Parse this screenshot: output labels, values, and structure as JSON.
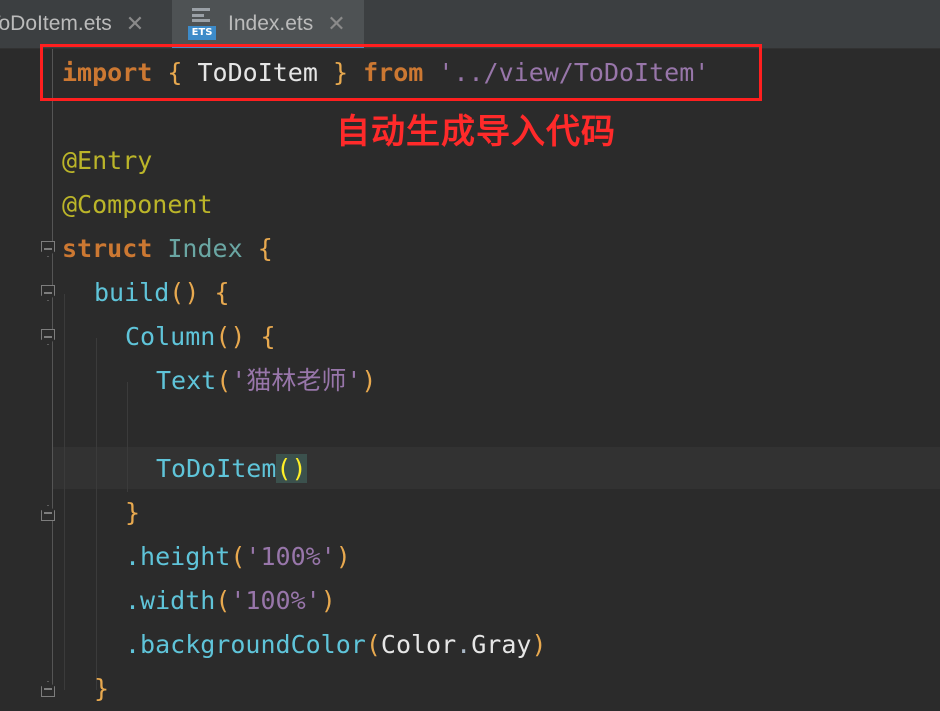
{
  "tabs": [
    {
      "label": "ToDoItem.ets",
      "close": "✕",
      "active": false
    },
    {
      "label": "Index.ets",
      "close": "✕",
      "active": true,
      "icon_badge": "ETS"
    }
  ],
  "code": {
    "l1": {
      "kw1": "import",
      "brace_open": "{",
      "ident": "ToDoItem",
      "brace_close": "}",
      "kw2": "from",
      "str": "'../view/ToDoItem'"
    },
    "l2": {
      "deco": "@Entry"
    },
    "l3": {
      "deco": "@Component"
    },
    "l4": {
      "kw": "struct",
      "type": "Index",
      "brace": "{"
    },
    "l5": {
      "fn": "build",
      "paren": "()",
      "brace": "{"
    },
    "l6": {
      "fn": "Column",
      "paren": "()",
      "brace": "{"
    },
    "l7": {
      "fn": "Text",
      "paren_open": "(",
      "str": "'猫林老师'",
      "paren_close": ")"
    },
    "l8": {
      "fn": "ToDoItem",
      "paren": "()"
    },
    "l9": {
      "brace": "}"
    },
    "l10": {
      "dot_fn": ".height",
      "paren_open": "(",
      "str": "'100%'",
      "paren_close": ")"
    },
    "l11": {
      "dot_fn": ".width",
      "paren_open": "(",
      "str": "'100%'",
      "paren_close": ")"
    },
    "l12": {
      "dot_fn": ".backgroundColor",
      "paren_open": "(",
      "arg1": "Color",
      "dot": ".",
      "arg2": "Gray",
      "paren_close": ")"
    },
    "l13": {
      "brace": "}"
    }
  },
  "annotation": "自动生成导入代码",
  "colors": {
    "highlight": "#ff1f1f",
    "annotation": "#ff2a2a",
    "active_tab_underline": "#4a88c7"
  }
}
